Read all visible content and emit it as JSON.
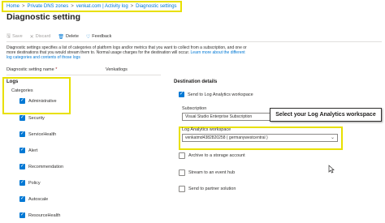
{
  "breadcrumb": [
    "Home",
    "Private DNS zones",
    "venkat.com | Activity log",
    "Diagnostic settings"
  ],
  "page_title": "Diagnostic setting",
  "toolbar": {
    "save": "Save",
    "discard": "Discard",
    "delete": "Delete",
    "feedback": "Feedback"
  },
  "description": {
    "text": "Diagnostic settings specifies a list of categories of platform logs and/or metrics that you want to collect from a subscription, and one or more destinations that you would stream them to. Normal usage charges for the destination will occur.",
    "link": "Learn more about the different log categories and contents of those logs"
  },
  "name_field": {
    "label": "Diagnostic setting name",
    "value": "Venkatlogs"
  },
  "logs": {
    "title": "Logs",
    "categories_label": "Categories",
    "items": [
      "Administrative",
      "Security",
      "ServiceHealth",
      "Alert",
      "Recommendation",
      "Policy",
      "Autoscale",
      "ResourceHealth"
    ]
  },
  "destination": {
    "title": "Destination details",
    "send_la": "Send to Log Analytics workspace",
    "subscription_label": "Subscription",
    "subscription_value": "Visual Studio Enterprise Subscription",
    "workspace_label": "Log Analytics workspace",
    "workspace_value": "venkatmd4382820258 ( germanywestcentral )",
    "archive": "Archive to a storage account",
    "stream": "Stream to an event hub",
    "partner": "Send to partner solution"
  },
  "callout": "Select your Log Analytics workspace",
  "colors": {
    "accent": "#0078d4",
    "highlight": "#e8e000"
  }
}
